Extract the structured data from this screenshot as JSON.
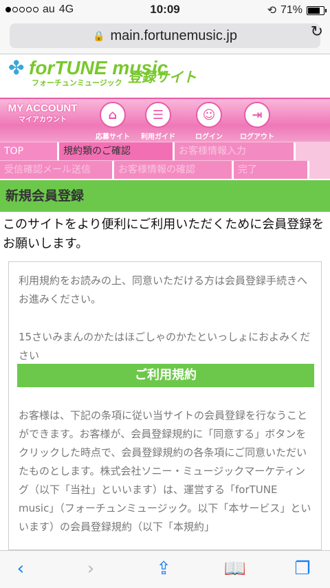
{
  "status": {
    "carrier": "au",
    "network": "4G",
    "time": "10:09",
    "battery": "71%"
  },
  "browser": {
    "url": "main.fortunemusic.jp"
  },
  "header": {
    "logo": "forTUNE music",
    "logo_sub": "フォーチュンミュージック",
    "title": "登録サイト"
  },
  "nav": {
    "myaccount": "MY ACCOUNT",
    "myaccount_sub": "マイアカウント",
    "items": [
      {
        "label": "応募サイト",
        "icon": "home-icon"
      },
      {
        "label": "利用ガイド",
        "icon": "document-icon"
      },
      {
        "label": "ログイン",
        "icon": "user-icon"
      },
      {
        "label": "ログアウト",
        "icon": "logout-icon"
      }
    ]
  },
  "steps": [
    "TOP",
    "規約類のご確認",
    "お客様情報入力",
    "受信確認メール送信",
    "お客様情報の確認",
    "完了"
  ],
  "section": {
    "title": "新規会員登録"
  },
  "intro": "このサイトをより便利にご利用いただくために会員登録をお願いします。",
  "terms": {
    "p1": "利用規約をお読みの上、同意いただける方は会員登録手続きへお進みください。",
    "p2": "15さいみまんのかたはほごしゃのかたといっしょにおよみください",
    "button": "ご利用規約",
    "p3": "お客様は、下記の条項に従い当サイトの会員登録を行なうことができます。お客様が、会員登録規約に「同意する」ボタンをクリックした時点で、会員登録規約の各条項にご同意いただいたものとします。株式会社ソニー・ミュージックマーケティング（以下「当社」といいます）は、運営する「forTUNE music」（フォーチュンミュージック。以下「本サービス」といいます）の会員登録規約（以下「本規約」"
  },
  "toolbar": {
    "icons": [
      "back-icon",
      "forward-icon",
      "share-icon",
      "bookmarks-icon",
      "tabs-icon"
    ]
  }
}
